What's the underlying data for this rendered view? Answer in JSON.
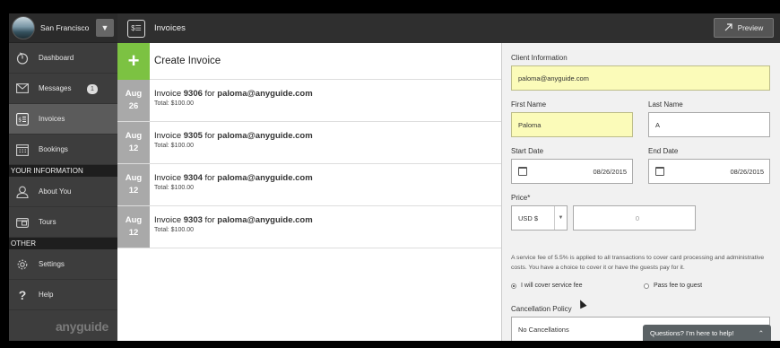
{
  "sidebar": {
    "city": "San Francisco",
    "dropdown_glyph": "▼",
    "items": [
      {
        "label": "Dashboard",
        "icon": "dashboard-icon"
      },
      {
        "label": "Messages",
        "icon": "envelope-icon",
        "badge": "1"
      },
      {
        "label": "Invoices",
        "icon": "invoice-icon"
      },
      {
        "label": "Bookings",
        "icon": "calendar-icon"
      }
    ],
    "section_your_info": "YOUR INFORMATION",
    "info_items": [
      {
        "label": "About You",
        "icon": "user-icon"
      },
      {
        "label": "Tours",
        "icon": "tours-icon"
      }
    ],
    "section_other": "OTHER",
    "other_items": [
      {
        "label": "Settings",
        "icon": "gear-icon"
      },
      {
        "label": "Help",
        "icon": "question-icon"
      }
    ],
    "brand": "anyguide"
  },
  "topbar": {
    "title": "Invoices",
    "preview_label": "Preview"
  },
  "list": {
    "create_label": "Create Invoice",
    "invoices": [
      {
        "month": "Aug",
        "day": "26",
        "prefix": "Invoice ",
        "number": "9306",
        "mid": " for ",
        "email": "paloma@anyguide.com",
        "total": "Total: $100.00"
      },
      {
        "month": "Aug",
        "day": "12",
        "prefix": "Invoice ",
        "number": "9305",
        "mid": " for ",
        "email": "paloma@anyguide.com",
        "total": "Total: $100.00"
      },
      {
        "month": "Aug",
        "day": "12",
        "prefix": "Invoice ",
        "number": "9304",
        "mid": " for ",
        "email": "paloma@anyguide.com",
        "total": "Total: $100.00"
      },
      {
        "month": "Aug",
        "day": "12",
        "prefix": "Invoice ",
        "number": "9303",
        "mid": " for ",
        "email": "paloma@anyguide.com",
        "total": "Total: $100.00"
      }
    ]
  },
  "form": {
    "client_info_label": "Client Information",
    "email_value": "paloma@anyguide.com",
    "first_name_label": "First Name",
    "first_name_value": "Paloma",
    "last_name_label": "Last Name",
    "last_name_value": "A",
    "start_date_label": "Start Date",
    "start_date_value": "08/26/2015",
    "end_date_label": "End Date",
    "end_date_value": "08/26/2015",
    "price_label": "Price*",
    "currency_value": "USD $",
    "price_value": "0",
    "fee_note": "A service fee of 5.5% is applied to all transactions to cover card processing and administrative costs. You have a choice to cover it or have the guests pay for it.",
    "radio_cover": "I will cover service fee",
    "radio_pass": "Pass fee to guest",
    "cancellation_label": "Cancellation Policy",
    "cancellation_value": "No Cancellations",
    "help_label": "Questions? I'm here to help!"
  }
}
